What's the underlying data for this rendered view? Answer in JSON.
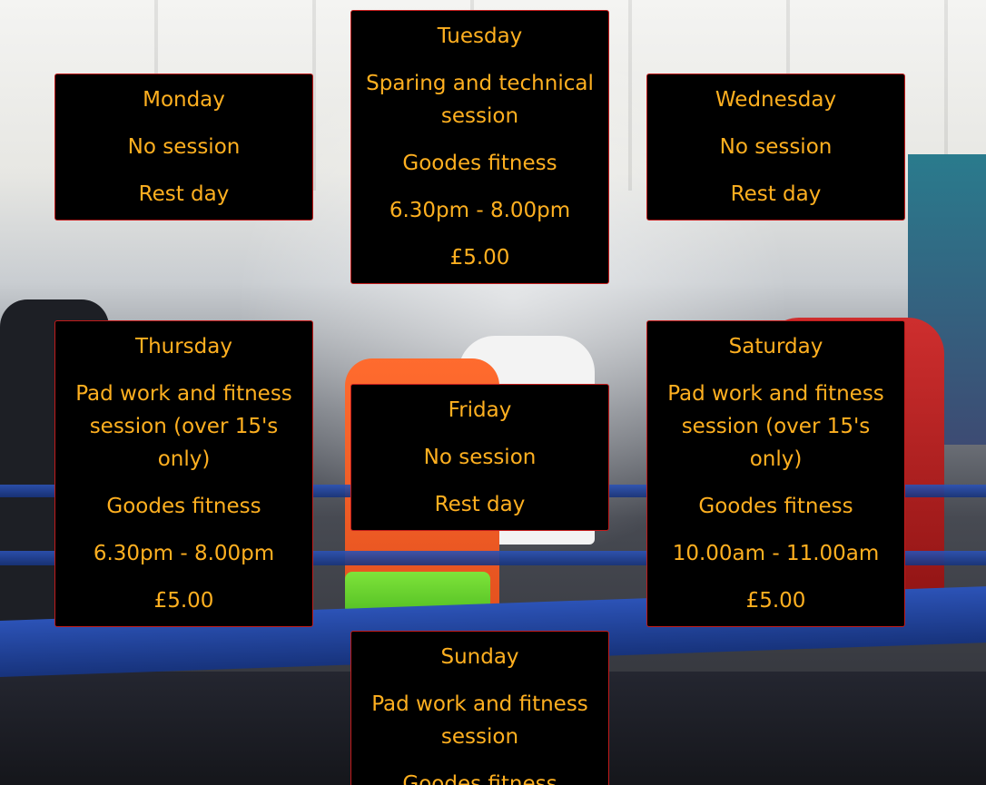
{
  "schedule": {
    "monday": {
      "day": "Monday",
      "lines": [
        "No session",
        "Rest day"
      ]
    },
    "tuesday": {
      "day": "Tuesday",
      "lines": [
        "Sparing and technical session",
        "Goodes fitness",
        "6.30pm - 8.00pm",
        "£5.00"
      ]
    },
    "wednesday": {
      "day": "Wednesday",
      "lines": [
        "No session",
        "Rest day"
      ]
    },
    "thursday": {
      "day": "Thursday",
      "lines": [
        "Pad work and fitness session (over 15's only)",
        "Goodes fitness",
        "6.30pm - 8.00pm",
        "£5.00"
      ]
    },
    "friday": {
      "day": "Friday",
      "lines": [
        "No session",
        "Rest day"
      ]
    },
    "saturday": {
      "day": "Saturday",
      "lines": [
        "Pad work and fitness session (over 15's only)",
        "Goodes fitness",
        "10.00am - 11.00am",
        "£5.00"
      ]
    },
    "sunday": {
      "day": "Sunday",
      "lines": [
        "Pad work and fitness session",
        "Goodes fitness"
      ]
    }
  },
  "colors": {
    "card_background": "#000000",
    "card_border": "#c21b1b",
    "card_text": "#ffb020"
  }
}
